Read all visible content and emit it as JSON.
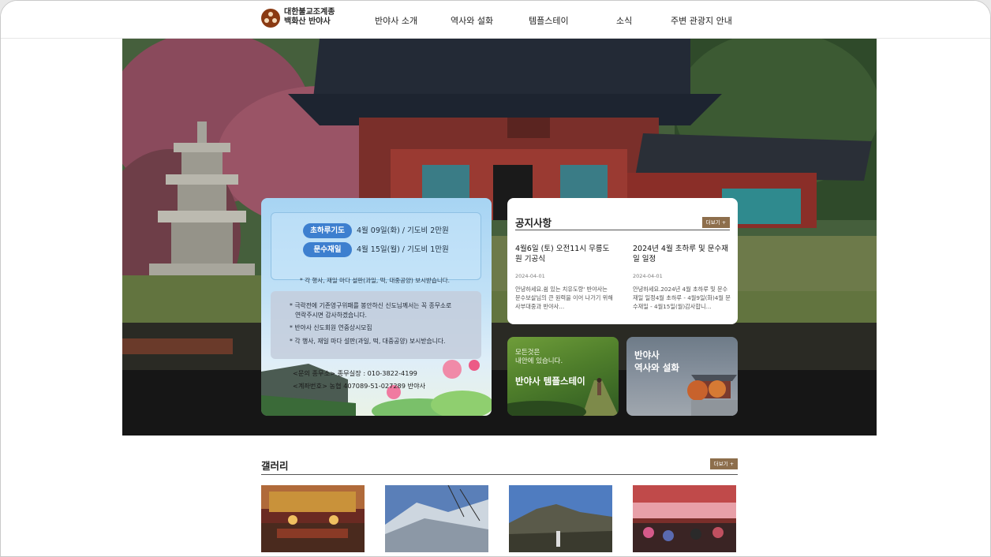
{
  "header": {
    "logo_line1": "대한불교조계종",
    "logo_line2": "백화산 반야사",
    "nav": [
      "반야사 소개",
      "역사와 설화",
      "템플스테이",
      "소식",
      "주변 관광지 안내"
    ]
  },
  "prayer": {
    "items": [
      {
        "label": "초하루기도",
        "desc": "4월 09일(화) / 기도비 2만원"
      },
      {
        "label": "문수재일",
        "desc": "4월 15일(월) / 기도비 1만원"
      }
    ],
    "note": "* 각 행사, 재일 마다 설판(과일, 떡, 대중공양) 보시받습니다.",
    "bullets": [
      "* 극락전에 기존영구위패를 봉안하신 신도님께서는 꼭 종무소로",
      "연락주시면 감사하겠습니다.",
      "* 반야사 신도회원 연중상시모집",
      "* 각 행사, 재일 마다 설판(과일, 떡, 대중공양) 보시받습니다."
    ],
    "contact_phone": "<문의 종무소> 종무실장 : 010-3822-4199",
    "contact_account": "<계좌번호> 농협 407089-51-027289 반야사"
  },
  "notice": {
    "title": "공지사항",
    "more": "더보기 +",
    "posts": [
      {
        "title": "4월6일 (토) 오전11시 무릉도원 기공식",
        "date": "2024-04-01",
        "body": "안녕하세요.쉼 있는 치유도량' 반야사는 문수보살님의 큰 원력을 이어 나가기 위해 사부대중과 반야사…"
      },
      {
        "title": "2024년 4월 초하루 및 문수재일 일정",
        "date": "2024-04-01",
        "body": "안녕하세요.2024년 4월 초하루 및 문수재일 일정4월 초하루 - 4월9일(화)4월 문수재일 - 4월15일(월)감사합니…"
      }
    ]
  },
  "promo": {
    "templestay_sub": "모든것은\n내안에 있습니다.",
    "templestay_title": "반야사 템플스테이",
    "history_title": "반야사\n역사와 설화"
  },
  "gallery": {
    "title": "갤러리",
    "more": "더보기 +"
  }
}
